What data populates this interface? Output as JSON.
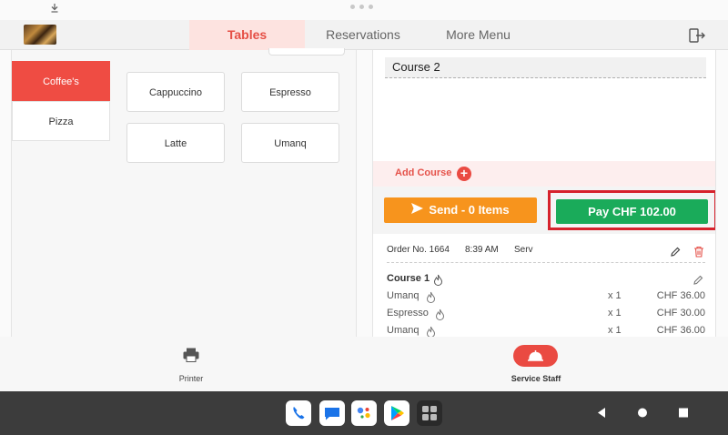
{
  "topnav": {
    "tabs": [
      {
        "label": "Tables"
      },
      {
        "label": "Reservations"
      },
      {
        "label": "More Menu"
      }
    ]
  },
  "categories": [
    {
      "label": "Coffee's"
    },
    {
      "label": "Pizza"
    }
  ],
  "items": [
    {
      "label": "Cappuccino"
    },
    {
      "label": "Espresso"
    },
    {
      "label": "Latte"
    },
    {
      "label": "Umanq"
    }
  ],
  "order": {
    "course_header": "Course 2",
    "add_course_label": "Add Course",
    "add_course_symbol": "+",
    "send_label": "Send - 0 Items",
    "pay_label": "Pay CHF 102.00",
    "order_no": "Order No. 1664",
    "time": "8:39 AM",
    "server": "Serv",
    "course1_label": "Course 1",
    "lines": [
      {
        "name": "Umanq",
        "qty": "x 1",
        "price": "CHF 36.00"
      },
      {
        "name": "Espresso",
        "qty": "x 1",
        "price": "CHF 30.00"
      },
      {
        "name": "Umanq",
        "qty": "x 1",
        "price": "CHF 36.00"
      }
    ]
  },
  "bottombar": {
    "printer_label": "Printer",
    "staff_label": "Service Staff"
  },
  "colors": {
    "accent": "#ef4c43",
    "send": "#f7941d",
    "pay": "#1aab5a",
    "highlight": "#d6222c"
  }
}
